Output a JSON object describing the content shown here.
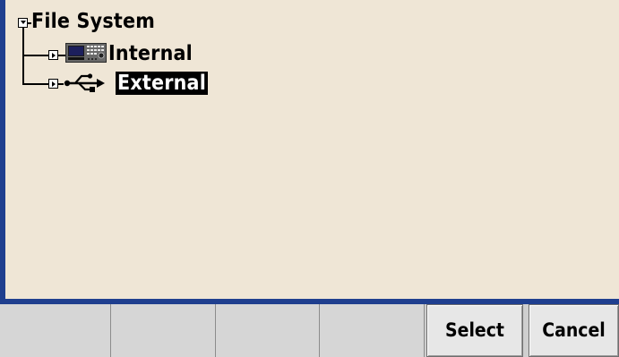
{
  "tree": {
    "root": {
      "label": "File System",
      "expanded": true
    },
    "items": [
      {
        "label": "Internal",
        "icon": "instrument-icon",
        "expanded": false,
        "selected": false
      },
      {
        "label": "External",
        "icon": "usb-icon",
        "expanded": false,
        "selected": true
      }
    ]
  },
  "softkeys": {
    "key1": "",
    "key2": "",
    "key3": "",
    "key4": "",
    "select": "Select",
    "cancel": "Cancel"
  },
  "colors": {
    "frame": "#1f3f8f",
    "panel_bg": "#efe6d6",
    "softkey_bg": "#d6d6d6",
    "selection_bg": "#000000",
    "selection_fg": "#ffffff"
  }
}
